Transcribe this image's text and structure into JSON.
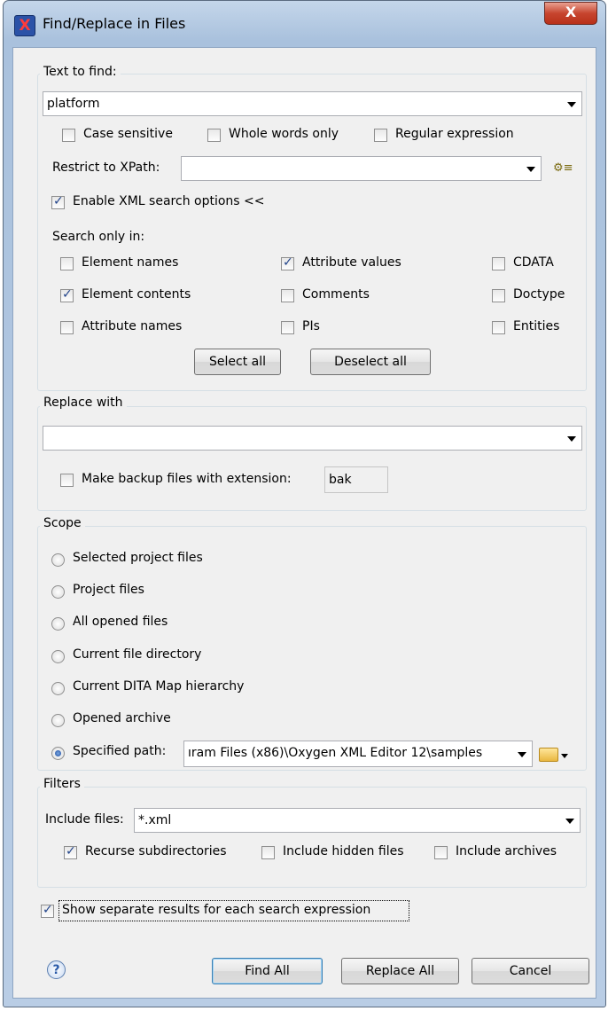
{
  "window": {
    "title": "Find/Replace in Files",
    "close_glyph": "X",
    "app_icon": "X"
  },
  "text_to_find": {
    "legend": "Text to find:",
    "value": "platform",
    "case_sensitive": {
      "label": "Case sensitive",
      "checked": false
    },
    "whole_words": {
      "label": "Whole words only",
      "checked": false
    },
    "regex": {
      "label": "Regular expression",
      "checked": false
    },
    "xpath_label": "Restrict to XPath:",
    "xpath_value": "",
    "enable_xml": {
      "label": "Enable XML search options <<",
      "checked": true
    },
    "search_only_in_label": "Search only in:",
    "options": {
      "element_names": {
        "label": "Element names",
        "checked": false
      },
      "attribute_values": {
        "label": "Attribute values",
        "checked": true
      },
      "cdata": {
        "label": "CDATA",
        "checked": false
      },
      "element_contents": {
        "label": "Element contents",
        "checked": true
      },
      "comments": {
        "label": "Comments",
        "checked": false
      },
      "doctype": {
        "label": "Doctype",
        "checked": false
      },
      "attribute_names": {
        "label": "Attribute names",
        "checked": false
      },
      "pis": {
        "label": "PIs",
        "checked": false
      },
      "entities": {
        "label": "Entities",
        "checked": false
      }
    },
    "select_all": "Select all",
    "deselect_all": "Deselect all"
  },
  "replace_with": {
    "legend": "Replace with",
    "value": "",
    "backup": {
      "label": "Make backup files with extension:",
      "checked": false,
      "extension": "bak"
    }
  },
  "scope": {
    "legend": "Scope",
    "options": [
      {
        "label": "Selected project files",
        "checked": false
      },
      {
        "label": "Project files",
        "checked": false
      },
      {
        "label": "All opened files",
        "checked": false
      },
      {
        "label": "Current file directory",
        "checked": false
      },
      {
        "label": "Current DITA Map hierarchy",
        "checked": false
      },
      {
        "label": "Opened archive",
        "checked": false
      },
      {
        "label": "Specified path:",
        "checked": true
      }
    ],
    "path_value": "ıram Files (x86)\\Oxygen XML Editor 12\\samples"
  },
  "filters": {
    "legend": "Filters",
    "include_label": "Include files:",
    "include_value": "*.xml",
    "recurse": {
      "label": "Recurse subdirectories",
      "checked": true
    },
    "hidden": {
      "label": "Include hidden files",
      "checked": false
    },
    "archives": {
      "label": "Include archives",
      "checked": false
    }
  },
  "separate_results": {
    "label": "Show separate results for each search expression",
    "checked": true
  },
  "buttons": {
    "find_all": "Find All",
    "replace_all": "Replace All",
    "cancel": "Cancel",
    "help": "?"
  },
  "colors": {
    "titlebar": "#b9cde5",
    "close": "#c7452f",
    "dialog_bg": "#f0f0f0",
    "check": "#22448a"
  }
}
